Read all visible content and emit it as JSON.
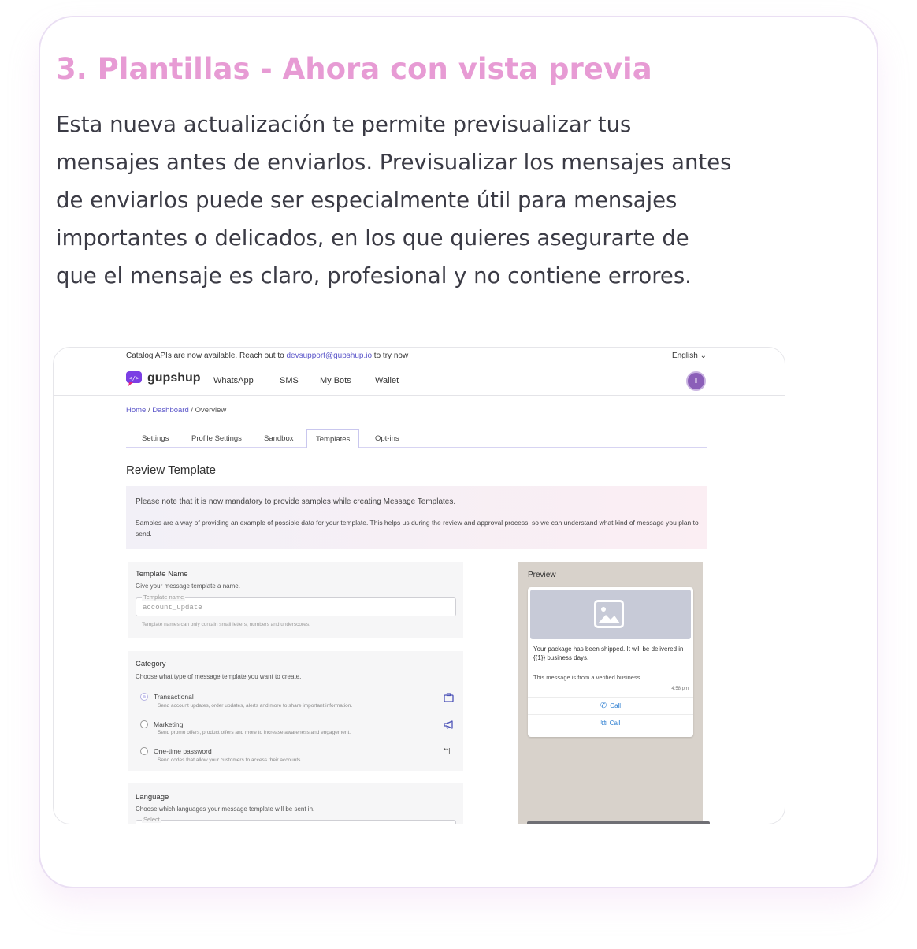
{
  "card": {
    "title": "3. Plantillas - Ahora con vista previa",
    "body": "Esta nueva actualización te permite previsualizar tus mensajes antes de enviarlos. Previsualizar los mensajes antes de enviarlos puede ser especialmente útil para mensajes importantes o delicados, en los que quieres asegurarte de que el mensaje es claro, profesional y no contiene errores."
  },
  "screenshot": {
    "announcement": {
      "prefix": "Catalog APIs are now available. Reach out to ",
      "link": "devsupport@gupshup.io",
      "suffix": " to try now"
    },
    "language_selector": "English ⌄",
    "brand": "gupshup",
    "nav": [
      "WhatsApp",
      "SMS",
      "My Bots",
      "Wallet"
    ],
    "avatar_initial": "I",
    "breadcrumb": {
      "home": "Home",
      "sep1": " / ",
      "dashboard": "Dashboard",
      "sep2": " / ",
      "current": "Overview"
    },
    "tabs": [
      "Settings",
      "Profile Settings",
      "Sandbox",
      "Templates",
      "Opt-ins"
    ],
    "active_tab": "Templates",
    "page_title": "Review Template",
    "notice": {
      "line1": "Please note that it is now mandatory to provide samples while creating Message Templates.",
      "line2": "Samples are a way of providing an example of possible data for your template. This helps us during the review and approval process, so we can  understand what kind of message you plan to send."
    },
    "template_name": {
      "heading": "Template Name",
      "subtitle": "Give your message template a name.",
      "field_label": "Template name",
      "field_value": "account_update",
      "hint": "Template names can only contain small letters, numbers and underscores."
    },
    "category": {
      "heading": "Category",
      "subtitle": "Choose what type of message template you want to create.",
      "options": [
        {
          "label": "Transactional",
          "desc": "Send account updates, order updates, alerts and more to share important information.",
          "icon": "briefcase-icon",
          "selected": true
        },
        {
          "label": "Marketing",
          "desc": "Send promo offers, product offers and more to increase awareness and engagement.",
          "icon": "megaphone-icon",
          "selected": false
        },
        {
          "label": "One-time password",
          "desc": "Send codes that allow your customers to access their accounts.",
          "icon": "password-icon",
          "selected": false
        }
      ]
    },
    "language": {
      "heading": "Language",
      "subtitle": "Choose which languages your message template will be sent in.",
      "field_label": "Select"
    },
    "preview": {
      "title": "Preview",
      "body": "Your package has been shipped. It will be delivered in {{1}} business days.",
      "footer": "This message is from a verified business.",
      "time": "4:58 pm",
      "buttons": [
        "Call",
        "Call"
      ]
    },
    "colors": {
      "title_pink": "#e79bd4",
      "link_purple": "#5a55c9",
      "button_blue": "#2e7fd1",
      "preview_bg": "#d8d2cb"
    }
  }
}
